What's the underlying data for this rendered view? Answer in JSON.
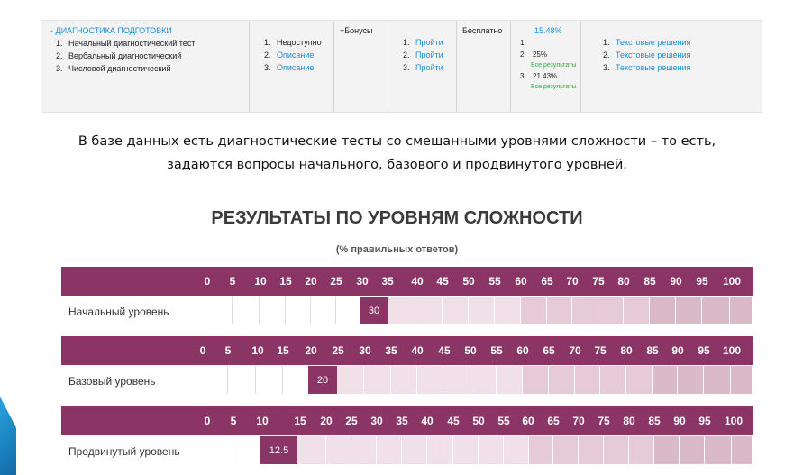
{
  "top_table": {
    "section_title": "-  ДИАГНОСТИКА ПОДГОТОВКИ",
    "tests": [
      {
        "n": "1.",
        "name": "Начальный диагностический тест"
      },
      {
        "n": "2.",
        "name": "Вербальный диагностический"
      },
      {
        "n": "3.",
        "name": "Числовой диагностический"
      }
    ],
    "status": [
      {
        "n": "1.",
        "text": "Недоступно",
        "link": false
      },
      {
        "n": "2.",
        "text": "Описание",
        "link": true
      },
      {
        "n": "3.",
        "text": "Описание",
        "link": true
      }
    ],
    "bonus": "+Бонусы",
    "take": [
      {
        "n": "1.",
        "text": "Пройти"
      },
      {
        "n": "2.",
        "text": "Пройти"
      },
      {
        "n": "3.",
        "text": "Пройти"
      }
    ],
    "price": "Бесплатно",
    "results_head": "15.48%",
    "results": [
      {
        "n": "1.",
        "value": "",
        "all": ""
      },
      {
        "n": "2.",
        "value": "25%",
        "all": "Все результаты"
      },
      {
        "n": "3.",
        "value": "21.43%",
        "all": "Все результаты"
      }
    ],
    "solutions": [
      {
        "n": "1.",
        "text": "Текстовые решения"
      },
      {
        "n": "2.",
        "text": "Текстовые решения"
      },
      {
        "n": "3.",
        "text": "Текстовые решения"
      }
    ]
  },
  "paragraph": {
    "line1": "В базе данных есть диагностические  тесты со смешанными уровнями сложности – то есть,",
    "line2": "задаются вопросы начального, базового и продвинутого уровней."
  },
  "chart_title": "РЕЗУЛЬТАТЫ ПО УРОВНЯМ СЛОЖНОСТИ",
  "chart_subtitle": "(% правильных ответов)",
  "colors": {
    "bar": "#8a3566",
    "cell_light": "#ffffff",
    "cell_pink": "#e8d3dd",
    "cell_pink2": "#dcbccd"
  },
  "chart_data": [
    {
      "type": "bar",
      "category": "Начальный уровень",
      "value": 30,
      "ticks": [
        "0",
        "5",
        "10",
        "15",
        "20",
        "25",
        "30",
        "35",
        "40",
        "45",
        "50",
        "55",
        "60",
        "65",
        "70",
        "75",
        "80",
        "85",
        "90",
        "95",
        "100"
      ],
      "xlim": [
        0,
        100
      ]
    },
    {
      "type": "bar",
      "category": "Базовый уровень",
      "value": 20,
      "ticks": [
        "0",
        "5",
        "10",
        "15",
        "20",
        "25",
        "30",
        "35",
        "40",
        "45",
        "50",
        "55",
        "60",
        "65",
        "70",
        "75",
        "80",
        "85",
        "90",
        "95",
        "100"
      ],
      "xlim": [
        0,
        100
      ]
    },
    {
      "type": "bar",
      "category": "Продвинутый уровень",
      "value": 12.5,
      "ticks": [
        "0",
        "5",
        "10",
        "15",
        "20",
        "25",
        "30",
        "35",
        "40",
        "45",
        "50",
        "55",
        "60",
        "65",
        "70",
        "75",
        "80",
        "85",
        "90",
        "95",
        "100"
      ],
      "xlim": [
        0,
        100
      ]
    }
  ]
}
